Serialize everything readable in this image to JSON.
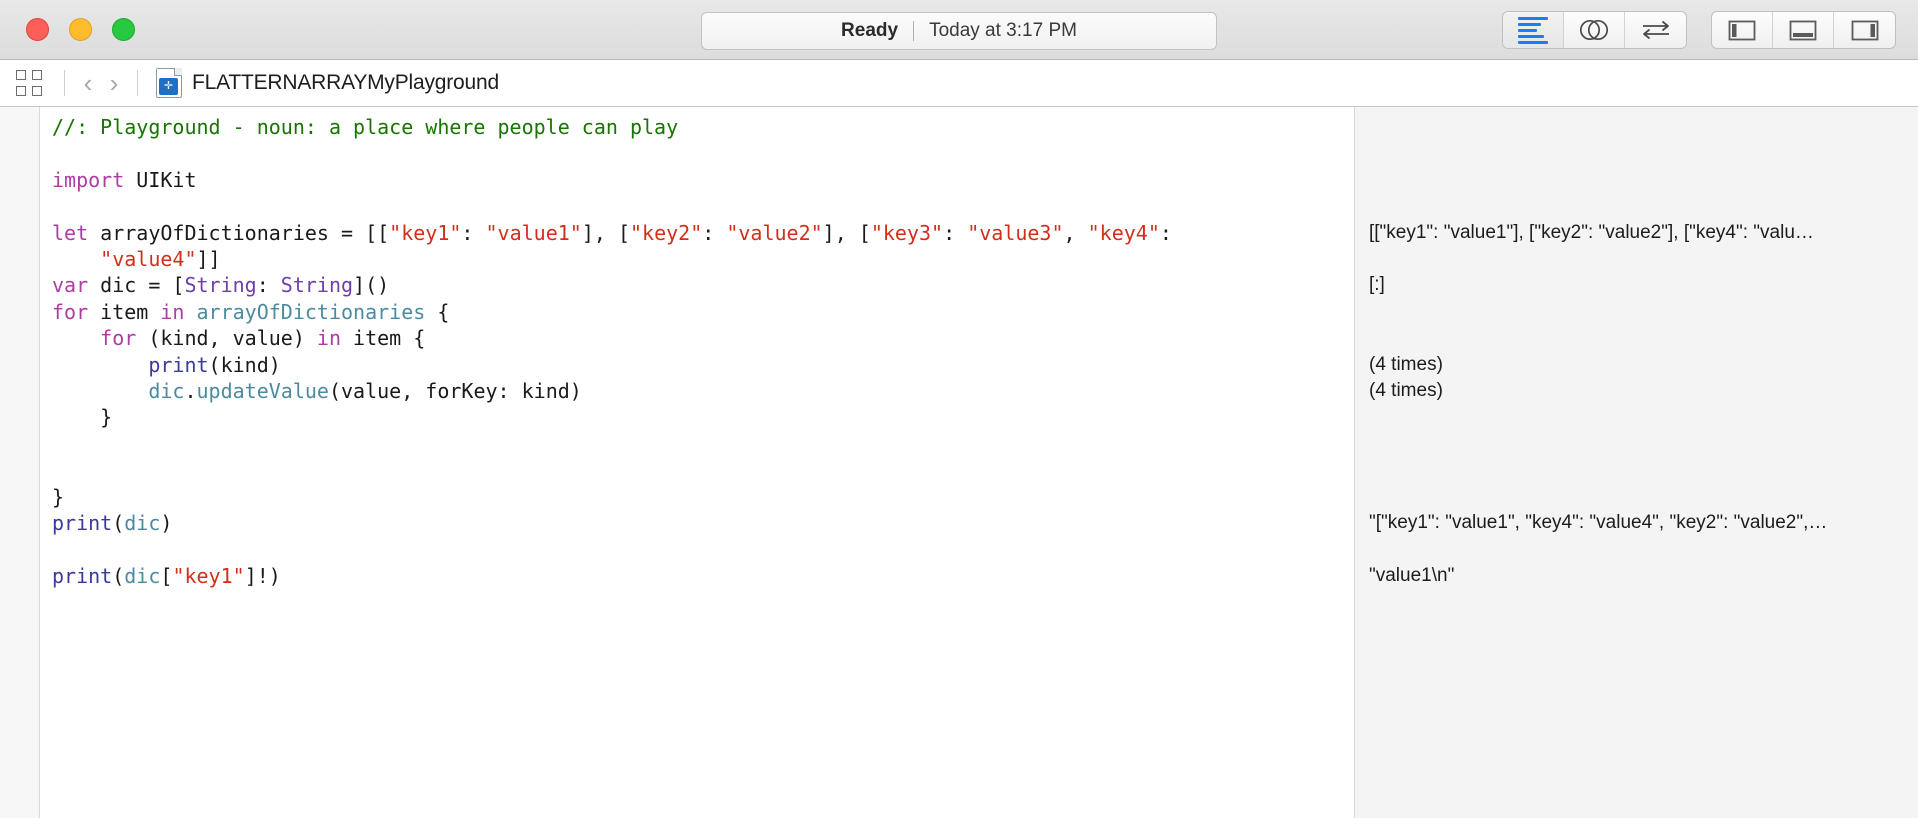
{
  "window": {
    "traffic_lights": [
      "close",
      "minimize",
      "maximize"
    ],
    "status": {
      "state": "Ready",
      "separator": "|",
      "timestamp": "Today at 3:17 PM"
    },
    "toolbar_right": {
      "editor_group": [
        {
          "name": "standard-editor",
          "icon": "lines-icon",
          "active": true
        },
        {
          "name": "assistant-editor",
          "icon": "venn-circles-icon",
          "active": false
        },
        {
          "name": "version-editor",
          "icon": "swap-arrows-icon",
          "active": false
        }
      ],
      "panel_group": [
        {
          "name": "toggle-navigator",
          "icon": "left-panel-icon"
        },
        {
          "name": "toggle-debug-area",
          "icon": "bottom-panel-icon"
        },
        {
          "name": "toggle-utilities",
          "icon": "right-panel-icon"
        }
      ]
    }
  },
  "jumpbar": {
    "grid_icon": "four-squares-icon",
    "back_chevron": "‹",
    "forward_chevron": "›",
    "file_icon": "playground-file-icon",
    "file_icon_glyph": "✛",
    "breadcrumb": "FLATTERNARRAYMyPlayground"
  },
  "editor": {
    "lines": [
      [
        {
          "t": "//: Playground - noun: a place where people can play",
          "c": "cmt"
        }
      ],
      [
        {
          "t": "",
          "c": "pln"
        }
      ],
      [
        {
          "t": "import",
          "c": "kw"
        },
        {
          "t": " UIKit",
          "c": "pln"
        }
      ],
      [
        {
          "t": "",
          "c": "pln"
        }
      ],
      [
        {
          "t": "let",
          "c": "kw"
        },
        {
          "t": " arrayOfDictionaries = [[",
          "c": "pln"
        },
        {
          "t": "\"key1\"",
          "c": "str"
        },
        {
          "t": ": ",
          "c": "pln"
        },
        {
          "t": "\"value1\"",
          "c": "str"
        },
        {
          "t": "], [",
          "c": "pln"
        },
        {
          "t": "\"key2\"",
          "c": "str"
        },
        {
          "t": ": ",
          "c": "pln"
        },
        {
          "t": "\"value2\"",
          "c": "str"
        },
        {
          "t": "], [",
          "c": "pln"
        },
        {
          "t": "\"key3\"",
          "c": "str"
        },
        {
          "t": ": ",
          "c": "pln"
        },
        {
          "t": "\"value3\"",
          "c": "str"
        },
        {
          "t": ", ",
          "c": "pln"
        },
        {
          "t": "\"key4\"",
          "c": "str"
        },
        {
          "t": ":",
          "c": "pln"
        }
      ],
      [
        {
          "t": "    ",
          "c": "pln"
        },
        {
          "t": "\"value4\"",
          "c": "str"
        },
        {
          "t": "]]",
          "c": "pln"
        }
      ],
      [
        {
          "t": "var",
          "c": "kw"
        },
        {
          "t": " dic = [",
          "c": "pln"
        },
        {
          "t": "String",
          "c": "typ"
        },
        {
          "t": ": ",
          "c": "pln"
        },
        {
          "t": "String",
          "c": "typ"
        },
        {
          "t": "]()",
          "c": "pln"
        }
      ],
      [
        {
          "t": "for",
          "c": "kw"
        },
        {
          "t": " item ",
          "c": "pln"
        },
        {
          "t": "in",
          "c": "kw"
        },
        {
          "t": " ",
          "c": "pln"
        },
        {
          "t": "arrayOfDictionaries",
          "c": "idv"
        },
        {
          "t": " {",
          "c": "pln"
        }
      ],
      [
        {
          "t": "    ",
          "c": "pln"
        },
        {
          "t": "for",
          "c": "kw"
        },
        {
          "t": " (kind, value) ",
          "c": "pln"
        },
        {
          "t": "in",
          "c": "kw"
        },
        {
          "t": " item {",
          "c": "pln"
        }
      ],
      [
        {
          "t": "        ",
          "c": "pln"
        },
        {
          "t": "print",
          "c": "fn"
        },
        {
          "t": "(kind)",
          "c": "pln"
        }
      ],
      [
        {
          "t": "        ",
          "c": "pln"
        },
        {
          "t": "dic",
          "c": "idv"
        },
        {
          "t": ".",
          "c": "pln"
        },
        {
          "t": "updateValue",
          "c": "idv"
        },
        {
          "t": "(value, forKey: kind)",
          "c": "pln"
        }
      ],
      [
        {
          "t": "    }",
          "c": "pln"
        }
      ],
      [
        {
          "t": "",
          "c": "pln"
        }
      ],
      [
        {
          "t": "",
          "c": "pln"
        }
      ],
      [
        {
          "t": "}",
          "c": "pln"
        }
      ],
      [
        {
          "t": "print",
          "c": "fn"
        },
        {
          "t": "(",
          "c": "pln"
        },
        {
          "t": "dic",
          "c": "idv"
        },
        {
          "t": ")",
          "c": "pln"
        }
      ],
      [
        {
          "t": "",
          "c": "pln"
        }
      ],
      [
        {
          "t": "print",
          "c": "fn"
        },
        {
          "t": "(",
          "c": "pln"
        },
        {
          "t": "dic",
          "c": "idv"
        },
        {
          "t": "[",
          "c": "pln"
        },
        {
          "t": "\"key1\"",
          "c": "str"
        },
        {
          "t": "]!)",
          "c": "pln"
        }
      ]
    ]
  },
  "results": {
    "lines": [
      "",
      "",
      "",
      "",
      "[[\"key1\": \"value1\"], [\"key2\": \"value2\"], [\"key4\": \"valu…",
      "",
      "[:]",
      "",
      "",
      "(4 times)",
      "(4 times)",
      "",
      "",
      "",
      "",
      "\"[\"key1\": \"value1\", \"key4\": \"value4\", \"key2\": \"value2\",…",
      "",
      "\"value1\\n\""
    ]
  }
}
